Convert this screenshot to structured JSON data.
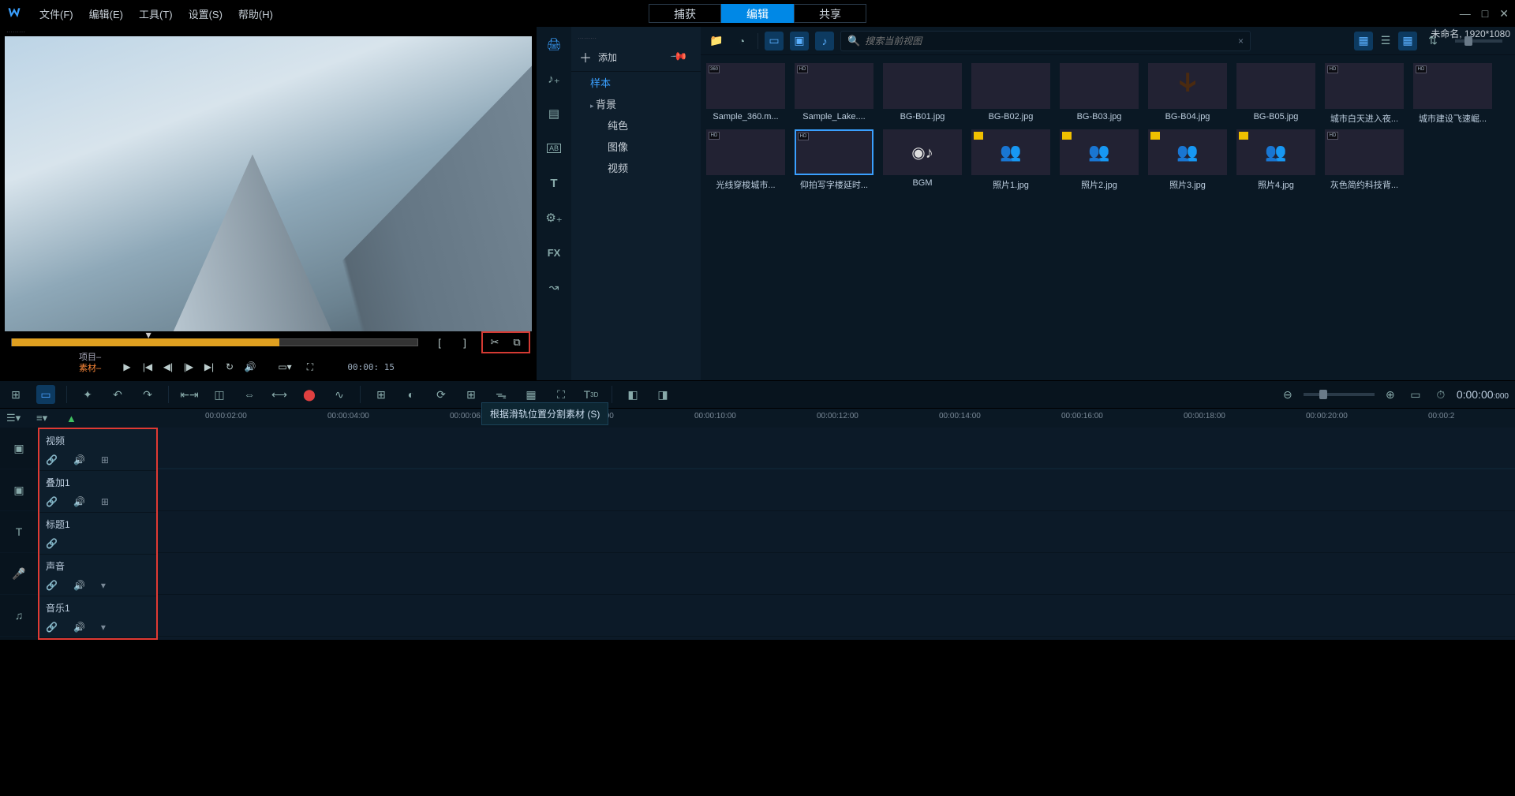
{
  "menu": {
    "file": "文件(F)",
    "edit": "编辑(E)",
    "tools": "工具(T)",
    "settings": "设置(S)",
    "help": "帮助(H)"
  },
  "modes": {
    "capture": "捕获",
    "edit": "编辑",
    "share": "共享"
  },
  "window": {
    "title": "未命名, 1920*1080"
  },
  "project_clip": {
    "project": "项目",
    "clip": "素材"
  },
  "timecode_small": "00:00: 15",
  "tooltip": "根据滑轨位置分割素材 (S)",
  "library": {
    "add": "添加",
    "tree": {
      "sample": "样本",
      "background": "背景",
      "solid": "纯色",
      "image": "图像",
      "video": "视频"
    },
    "search_placeholder": "搜索当前视图"
  },
  "thumbs": [
    {
      "label": "Sample_360.m...",
      "cls": "t-sky",
      "badge": "360"
    },
    {
      "label": "Sample_Lake....",
      "cls": "t-lake",
      "badge": "HD"
    },
    {
      "label": "BG-B01.jpg",
      "cls": "t-green1"
    },
    {
      "label": "BG-B02.jpg",
      "cls": "t-green2"
    },
    {
      "label": "BG-B03.jpg",
      "cls": "t-sunset"
    },
    {
      "label": "BG-B04.jpg",
      "cls": "t-desert"
    },
    {
      "label": "BG-B05.jpg",
      "cls": "t-red"
    },
    {
      "label": "城市白天进入夜...",
      "cls": "t-city1",
      "badge": "HD"
    },
    {
      "label": "城市建设飞速崛...",
      "cls": "t-city2",
      "badge": "HD"
    },
    {
      "label": "光线穿梭城市...",
      "cls": "t-night",
      "badge": "HD"
    },
    {
      "label": "仰拍写字楼延时...",
      "cls": "t-build",
      "badge": "HD",
      "sel": true
    },
    {
      "label": "BGM",
      "cls": "t-bgm"
    },
    {
      "label": "照片1.jpg",
      "cls": "t-ppl1",
      "yb": true
    },
    {
      "label": "照片2.jpg",
      "cls": "t-ppl2",
      "yb": true
    },
    {
      "label": "照片3.jpg",
      "cls": "t-ppl3",
      "yb": true
    },
    {
      "label": "照片4.jpg",
      "cls": "t-ppl4",
      "yb": true
    },
    {
      "label": "灰色简约科技背...",
      "cls": "t-grey",
      "badge": "HD"
    }
  ],
  "timeline": {
    "timecode": "0:00:00",
    "timecode_ms": ":000",
    "ruler": [
      "00:00:02:00",
      "00:00:04:00",
      "00:00:06:00",
      "00:00:08:00",
      "00:00:10:00",
      "00:00:12:00",
      "00:00:14:00",
      "00:00:16:00",
      "00:00:18:00",
      "00:00:20:00",
      "00:00:2"
    ]
  },
  "tracks": [
    {
      "type": "▣",
      "name": "视频",
      "icons": [
        "🔗",
        "🔊",
        "⊞"
      ]
    },
    {
      "type": "▣",
      "name": "叠加1",
      "icons": [
        "🔗",
        "🔊",
        "⊞"
      ]
    },
    {
      "type": "T",
      "name": "标题1",
      "icons": [
        "🔗"
      ]
    },
    {
      "type": "🎤",
      "name": "声音",
      "icons": [
        "🔗",
        "🔊",
        "▾"
      ]
    },
    {
      "type": "♫",
      "name": "音乐1",
      "icons": [
        "🔗",
        "🔊",
        "▾"
      ]
    }
  ]
}
